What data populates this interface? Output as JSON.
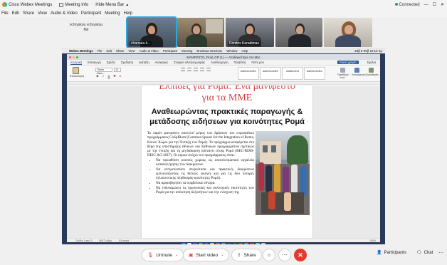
{
  "app": {
    "title": "Cisco Webex Meetings",
    "meeting_info": "Meeting Info",
    "hide_menu_bar": "Hide Menu Bar",
    "connection_status": "Connected"
  },
  "menu": [
    "File",
    "Edit",
    "Share",
    "View",
    "Audio & Video",
    "Participant",
    "Meeting",
    "Help"
  ],
  "participants": {
    "self_name": "vchryskou vchryskou",
    "self_sub": "Me",
    "tiles": [
      {
        "name": "charoula k..."
      },
      {
        "name": ""
      },
      {
        "name": "Dimitris Karadimas"
      },
      {
        "name": ""
      },
      {
        "name": ""
      }
    ]
  },
  "mac_menu": {
    "items": [
      "Webex Meetings",
      "File",
      "Edit",
      "Share",
      "View",
      "Audio & Video",
      "Participant",
      "Meeting",
      "Breakout Sessions",
      "Window",
      "Help"
    ],
    "clock": "Σάβ 8 Φεβ  10:10 πμ"
  },
  "word": {
    "document_title": "MANIFESTO_Final_GR (1) — Αποθηκεύτηκε στο Mac",
    "tabs": [
      "Κεντρική",
      "Εισαγωγή",
      "Σχέδιο",
      "Σχεδίαση",
      "Διάταξη",
      "Αναφορές",
      "Στοιχεία αλληλογραφίας",
      "Αναθεώρηση",
      "Προβολή",
      "Πείτε μου"
    ],
    "share_button": "Κοινή χρήση",
    "comments_button": "Σχόλια",
    "paste_label": "Επικόλληση",
    "font_name": "Times New...",
    "font_size": "12",
    "styles": [
      "AaBbCcDdEe",
      "AaBbCcDdEe",
      "AaBbCcDd",
      "AaBbCcDdEe"
    ],
    "right_buttons": [
      "Παράθυρο στυλ",
      "Υπαγόρευση",
      "Ευαισθησία"
    ],
    "status_left": "Σελίδα 1 από 3",
    "status_words": "5047 λέξεις",
    "status_lang": "Ελληνικά",
    "zoom": "150%"
  },
  "document": {
    "red_title_line1": "Ελπίδες για Ρομά: Ένα μανιφέστο",
    "red_title_line2": "για τα ΜΜΕ",
    "subtitle": "Αναθεωρώντας πρακτικές παραγωγής & μετάδοσης ειδήσεων για κοινότητες Ρομά",
    "paragraph": "Το παρόν μανιφέστο αποτελεί μέρος των δράσεων του ευρωπαϊκού προγράμματος CoSpIRom (Common Spaces for the Integration of Roma, Κοινοί Χώροι για την Ένταξη των Ρομά). Το πρόγραμμα αναφέρεται στο θέμα της υποστήριξης εθνικών και διεθνικών προγραμμάτων σχετικών με την ένταξη και τη μη-διάκριση απέναντι στους Ρομά (REC-RDIS-DISC-AG-2017). Οι κύριοι στόχοι του προγράμματος είναι:",
    "bullets": [
      "Να προωθήσει κοινούς χώρους ως αποτελεσματικά εργαλεία καταπολέμησης των διακρίσεων.",
      "Να αντιμετωπίσει στερεότυπα και πρακτικές διακρίσεων εμπλουτίζοντας τις θετικές εικόνες και για τις δύο πλευρές (πλειονοτικής πληθυσμός-κοινότητες Ρομά).",
      "Να αμφισβητήσει τα συμβολικά σύνορα.",
      "Να ενδυναμώσει τις προσωπικές και συλλογικές ταυτότητες των Ρομά για την απόκτηση δεξιοτήτων και την ενίσχυση της"
    ]
  },
  "controls": {
    "unmute": "Unmute",
    "start_video": "Start video",
    "share": "Share",
    "participants": "Participants",
    "chat": "Chat"
  },
  "colors": {
    "end_call": "#e43a2e",
    "active_speaker": "#2aa8e0",
    "title_red": "#d42c2c",
    "word_blue": "#2b579a"
  }
}
